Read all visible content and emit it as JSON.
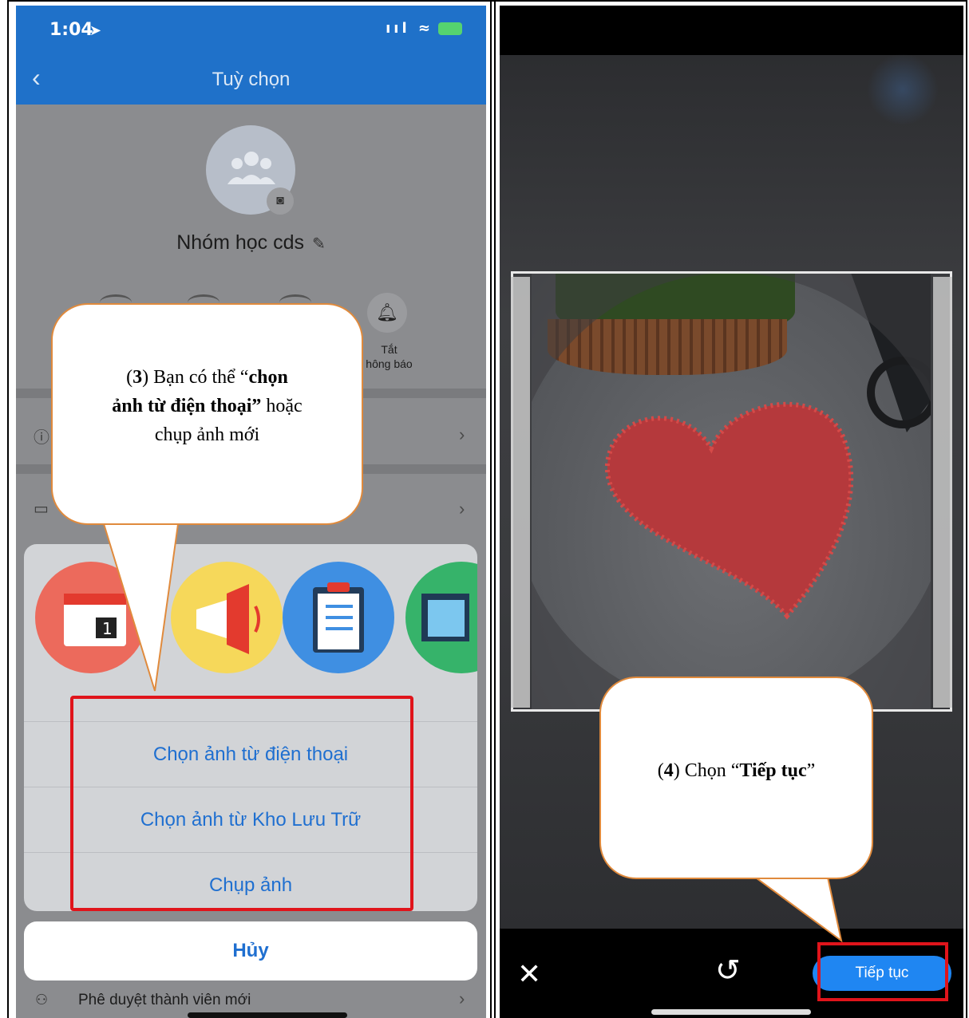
{
  "left_screen": {
    "status_time": "1:04",
    "nav_back": "‹",
    "nav_title": "Tuỳ chọn",
    "group_name": "Nhóm học cds",
    "mute_label_line1": "Tắt",
    "mute_label_line2": "hông báo",
    "options": [
      {
        "label": "Chọn ảnh từ điện thoại"
      },
      {
        "label": "Chọn ảnh từ Kho Lưu Trữ"
      },
      {
        "label": "Chụp ảnh"
      }
    ],
    "cancel_label": "Hủy",
    "approve_label": "Phê duyệt thành viên mới"
  },
  "callout_left": {
    "open_paren": "(",
    "number": "3",
    "close_paren_text": ") Bạn có thể “",
    "bold_1": "chọn",
    "bold_2": "ảnh từ điện thoại”",
    "after_bold": " hoặc",
    "line3": "chụp ảnh mới"
  },
  "right_screen": {
    "next_label": "Tiếp tục"
  },
  "callout_right": {
    "open_paren": "(",
    "number": "4",
    "middle": ") Chọn “",
    "bold": "Tiếp tục",
    "close": "”"
  },
  "colors": {
    "accent_blue": "#1f71c9",
    "option_blue": "#1f6fd0",
    "highlight_red": "#e0141b",
    "callout_border": "#e08a3c"
  }
}
